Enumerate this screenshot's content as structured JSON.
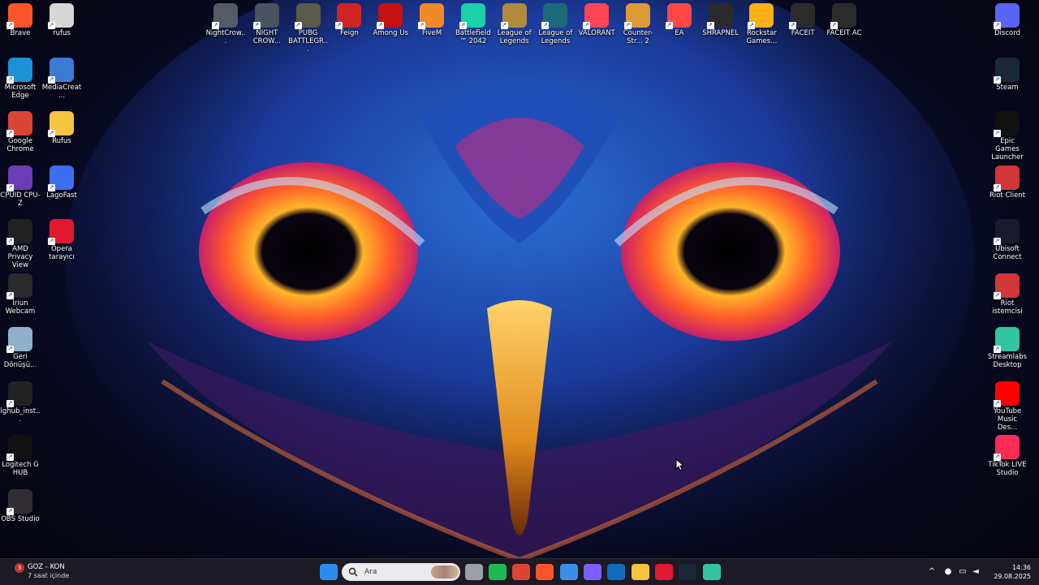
{
  "left_icons": [
    {
      "label": "Brave",
      "icon": "brave-icon",
      "color": "#fb542b"
    },
    {
      "label": "Microsoft Edge",
      "icon": "edge-icon",
      "color": "#1e90d6"
    },
    {
      "label": "Google Chrome",
      "icon": "chrome-icon",
      "color": "#db4437"
    },
    {
      "label": "CPUID CPU-Z",
      "icon": "cpuz-icon",
      "color": "#6d3bb5"
    },
    {
      "label": "AMD Privacy View",
      "icon": "amd-eye-icon",
      "color": "#222222"
    },
    {
      "label": "Iriun Webcam",
      "icon": "iriun-icon",
      "color": "#2a2a2a"
    },
    {
      "label": "Geri Dönüşü...",
      "icon": "recycle-bin-icon",
      "color": "#8fb0c8"
    },
    {
      "label": "lghub_inst...",
      "icon": "logitech-installer-icon",
      "color": "#222222"
    },
    {
      "label": "Logitech G HUB",
      "icon": "logitech-ghub-icon",
      "color": "#111111"
    },
    {
      "label": "OBS Studio",
      "icon": "obs-icon",
      "color": "#302e31"
    }
  ],
  "left_icons_col2": [
    {
      "label": "rufus",
      "icon": "rufus-file-icon",
      "color": "#d7d7d7"
    },
    {
      "label": "MediaCreat...",
      "icon": "media-creation-icon",
      "color": "#3a7bd5"
    },
    {
      "label": "Rufus",
      "icon": "folder-icon",
      "color": "#f5c542"
    },
    {
      "label": "LagoFast",
      "icon": "lagofast-icon",
      "color": "#3c6ff0"
    },
    {
      "label": "Opera tarayıcı",
      "icon": "opera-icon",
      "color": "#e0192e"
    }
  ],
  "top_icons": [
    {
      "label": "NightCrow...",
      "icon": "nightcrow-icon",
      "color": "#555b66"
    },
    {
      "label": "NIGHT CROW...",
      "icon": "nightcrow2-icon",
      "color": "#4b5260"
    },
    {
      "label": "PUBG BATTLEGR...",
      "icon": "pubg-icon",
      "color": "#5a5a48"
    },
    {
      "label": "Feign",
      "icon": "feign-icon",
      "color": "#d02424"
    },
    {
      "label": "Among Us",
      "icon": "among-us-icon",
      "color": "#c51111"
    },
    {
      "label": "FiveM",
      "icon": "fivem-icon",
      "color": "#f08a24"
    },
    {
      "label": "Battlefield™ 2042",
      "icon": "battlefield-icon",
      "color": "#1bd1a8"
    },
    {
      "label": "League of Legends",
      "icon": "lol-icon",
      "color": "#b08b3e"
    },
    {
      "label": "League of Legends",
      "icon": "lol2-icon",
      "color": "#1c6a78"
    },
    {
      "label": "VALORANT",
      "icon": "valorant-icon",
      "color": "#fd4556"
    },
    {
      "label": "Counter-Str... 2",
      "icon": "cs2-icon",
      "color": "#de9b35"
    },
    {
      "label": "EA",
      "icon": "ea-icon",
      "color": "#ff4747"
    },
    {
      "label": "SHRAPNEL",
      "icon": "shrapnel-icon",
      "color": "#2a2a2a"
    },
    {
      "label": "Rockstar Games...",
      "icon": "rockstar-icon",
      "color": "#fcaf17"
    },
    {
      "label": "FACEIT",
      "icon": "faceit-icon",
      "color": "#2b2b2b"
    },
    {
      "label": "FACEIT AC",
      "icon": "faceit-ac-icon",
      "color": "#2b2b2b"
    }
  ],
  "right_icons": [
    {
      "label": "Discord",
      "icon": "discord-icon",
      "color": "#5865f2"
    },
    {
      "label": "Steam",
      "icon": "steam-icon",
      "color": "#1b2838"
    },
    {
      "label": "Epic Games Launcher",
      "icon": "epic-games-icon",
      "color": "#111111"
    },
    {
      "label": "Riot Client",
      "icon": "riot-client-icon",
      "color": "#d13639"
    },
    {
      "label": "Ubisoft Connect",
      "icon": "ubisoft-icon",
      "color": "#1a1a2e"
    },
    {
      "label": "Riot istemcisi",
      "icon": "riot-istemcisi-icon",
      "color": "#d13639"
    },
    {
      "label": "Streamlabs Desktop",
      "icon": "streamlabs-icon",
      "color": "#31c3a2"
    },
    {
      "label": "YouTube Music Des...",
      "icon": "youtube-music-icon",
      "color": "#ff0000"
    },
    {
      "label": "TikTok LIVE Studio",
      "icon": "tiktok-icon",
      "color": "#fe2c55"
    }
  ],
  "taskbar": {
    "widget_badge": "3",
    "widget_title": "GOZ - KON",
    "widget_sub": "7 saat içinde",
    "search_placeholder": "Ara",
    "clock_time": "14:36",
    "clock_date": "29.08.2025",
    "pinned": [
      {
        "icon": "windows-start-icon",
        "color": "#2b8cf0"
      },
      {
        "icon": "task-view-icon",
        "color": "#9aa0a6"
      },
      {
        "icon": "spotify-icon",
        "color": "#1db954"
      },
      {
        "icon": "chrome-taskbar-icon",
        "color": "#db4437"
      },
      {
        "icon": "brave-taskbar-icon",
        "color": "#fb542b"
      },
      {
        "icon": "store-icon",
        "color": "#3a8ee6"
      },
      {
        "icon": "copilot-icon",
        "color": "#7a5cff"
      },
      {
        "icon": "outlook-icon",
        "color": "#0f6cbd"
      },
      {
        "icon": "file-explorer-icon",
        "color": "#f5c542"
      },
      {
        "icon": "opera-taskbar-icon",
        "color": "#e0192e"
      },
      {
        "icon": "steam-taskbar-icon",
        "color": "#1b2838"
      },
      {
        "icon": "streamlabs-taskbar-icon",
        "color": "#31c3a2"
      }
    ]
  }
}
